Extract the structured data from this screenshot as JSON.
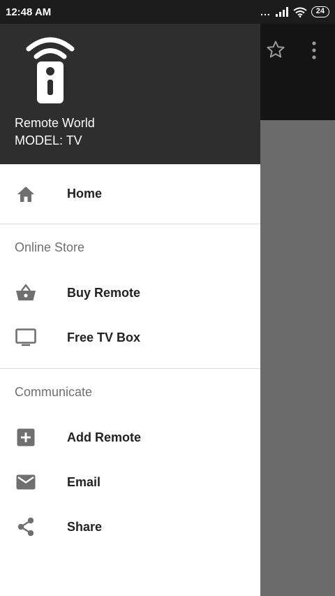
{
  "status_bar": {
    "time": "12:48 AM",
    "signal_dots": "...",
    "battery": "24"
  },
  "drawer": {
    "header": {
      "app_name": "Remote World",
      "model": "MODEL: TV"
    },
    "items": {
      "home": {
        "label": "Home",
        "icon": "home-icon"
      },
      "buy_remote": {
        "label": "Buy Remote",
        "icon": "basket-icon"
      },
      "free_tv_box": {
        "label": "Free TV Box",
        "icon": "tv-icon"
      },
      "add_remote": {
        "label": "Add Remote",
        "icon": "add-box-icon"
      },
      "email": {
        "label": "Email",
        "icon": "email-icon"
      },
      "share": {
        "label": "Share",
        "icon": "share-icon"
      }
    },
    "sections": {
      "online_store": "Online Store",
      "communicate": "Communicate"
    }
  },
  "colors": {
    "header_bg": "#2e2e2e",
    "icon_gray": "#6f6f6f",
    "scrim": "#6b6b6b"
  }
}
